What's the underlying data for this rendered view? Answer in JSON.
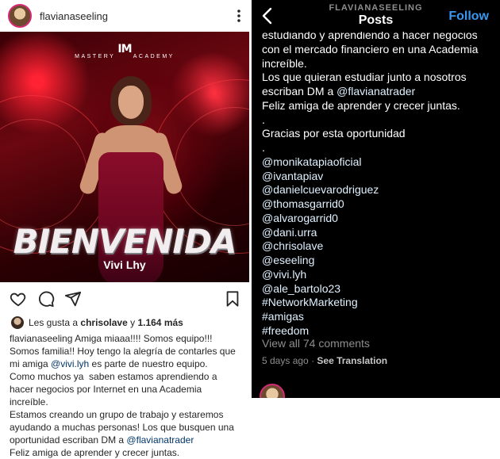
{
  "left": {
    "username": "flavianaseeling",
    "post_image": {
      "brand_mark": "IM",
      "brand_left": "MASTERY",
      "brand_right": "ACADEMY",
      "headline": "BIENVENIDA",
      "subline": "Vivi Lhy"
    },
    "likes": {
      "prefix": "Les gusta a",
      "user": "chrisolave",
      "joiner": "y",
      "count": "1.164 más"
    },
    "caption": {
      "user": "flavianaseeling",
      "line1": " Amiga miaaa!!!! Somos equipo!!!",
      "line2": "Somos familia!! Hoy tengo la alegría de contarles que",
      "line3a": "mi amiga ",
      "mention1": "@vivi.lyh",
      "line3b": " es parte de nuestro equipo.",
      "line4": "Como muchos ya  saben estamos aprendiendo a",
      "line5": "hacer negocios por Internet en una Academia",
      "line6": "increíble.",
      "line7": "Estamos creando un grupo de trabajo y estaremos",
      "line8": "ayudando a muchas personas! Los que busquen una",
      "line9a": "oportunidad escriban DM a ",
      "mention2": "@flavianatrader",
      "line10": "Feliz amiga de aprender y crecer juntas."
    }
  },
  "right": {
    "header_user": "FLAVIANASEELING",
    "header_title": "Posts",
    "follow_label": "Follow",
    "lines": [
      {
        "text": "estudiando y aprendiendo a hacer negocios",
        "kind": "text"
      },
      {
        "text": "con el mercado financiero en una Academia",
        "kind": "text"
      },
      {
        "text": "increíble.",
        "kind": "text"
      },
      {
        "text": "Los que quieran estudiar junto a nosotros",
        "kind": "text"
      },
      {
        "text": "escriban DM a ",
        "kind": "text",
        "mention": "@flavianatrader"
      },
      {
        "text": "Feliz amiga de aprender y crecer juntas.",
        "kind": "text"
      },
      {
        "text": ".",
        "kind": "text"
      },
      {
        "text": "Gracias por esta oportunidad",
        "kind": "text"
      },
      {
        "text": ".",
        "kind": "text"
      },
      {
        "text": "@monikatapiaoficial",
        "kind": "mention"
      },
      {
        "text": "@ivantapiav",
        "kind": "mention"
      },
      {
        "text": "@danielcuevarodriguez",
        "kind": "mention"
      },
      {
        "text": "@thomasgarrid0",
        "kind": "mention"
      },
      {
        "text": "@alvarogarrid0",
        "kind": "mention"
      },
      {
        "text": "@dani.urra",
        "kind": "mention"
      },
      {
        "text": "@chrisolave",
        "kind": "mention"
      },
      {
        "text": "@eseeling",
        "kind": "mention"
      },
      {
        "text": "@vivi.lyh",
        "kind": "mention"
      },
      {
        "text": "@ale_bartolo23",
        "kind": "mention"
      },
      {
        "text": "#NetworkMarketing",
        "kind": "tag"
      },
      {
        "text": "#amigas",
        "kind": "tag"
      },
      {
        "text": "#freedom",
        "kind": "tag"
      }
    ],
    "view_all": "View all 74 comments",
    "age": "5 days ago",
    "dot": "·",
    "see_translation": "See Translation"
  },
  "colors": {
    "link": "#00376b",
    "follow": "#3897f0",
    "muted": "#8e8e8e",
    "ring": "#d62976"
  },
  "icons": [
    "more-vertical-icon",
    "heart-icon",
    "comment-icon",
    "send-icon",
    "bookmark-icon",
    "back-chevron-icon"
  ]
}
